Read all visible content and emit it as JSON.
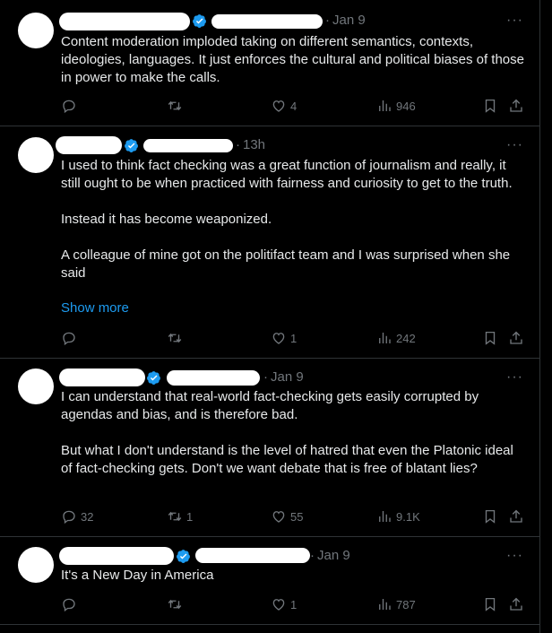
{
  "tweets": [
    {
      "time": "Jan 9",
      "text": "Content moderation imploded taking on different semantics, contexts, ideologies, languages. It just enforces the cultural and political biases of those in power to make the calls.",
      "show_more": "",
      "reply_count": "",
      "retweet_count": "",
      "like_count": "4",
      "view_count": "946"
    },
    {
      "time": "13h",
      "text": "I used to think fact checking was a great function of journalism and really, it still ought to be when practiced with fairness and curiosity to get to the truth.\n\nInstead it has become weaponized.\n\nA colleague of mine got on the politifact team and I was surprised when she said",
      "show_more": "Show more",
      "reply_count": "",
      "retweet_count": "",
      "like_count": "1",
      "view_count": "242"
    },
    {
      "time": "Jan 9",
      "text": "I can understand that real-world fact-checking gets easily corrupted by agendas and bias, and is therefore bad.\n\nBut what I don't understand is the level of hatred that even the Platonic ideal of fact-checking gets. Don't we want debate that is free of blatant lies?",
      "show_more": "",
      "reply_count": "32",
      "retweet_count": "1",
      "like_count": "55",
      "view_count": "9.1K"
    },
    {
      "time": "Jan 9",
      "text": "It's a New Day in America",
      "show_more": "",
      "reply_count": "",
      "retweet_count": "",
      "like_count": "1",
      "view_count": "787"
    }
  ],
  "colors": {
    "background": "#000000",
    "text": "#e7e9ea",
    "muted": "#71767b",
    "link": "#1d9bf0",
    "verified": "#1d9bf0",
    "divider": "#2f3336"
  },
  "icons": {
    "verified": "verified-badge-icon",
    "more": "more-icon",
    "reply": "reply-icon",
    "retweet": "retweet-icon",
    "like": "like-icon",
    "views": "views-icon",
    "bookmark": "bookmark-icon",
    "share": "share-icon"
  }
}
